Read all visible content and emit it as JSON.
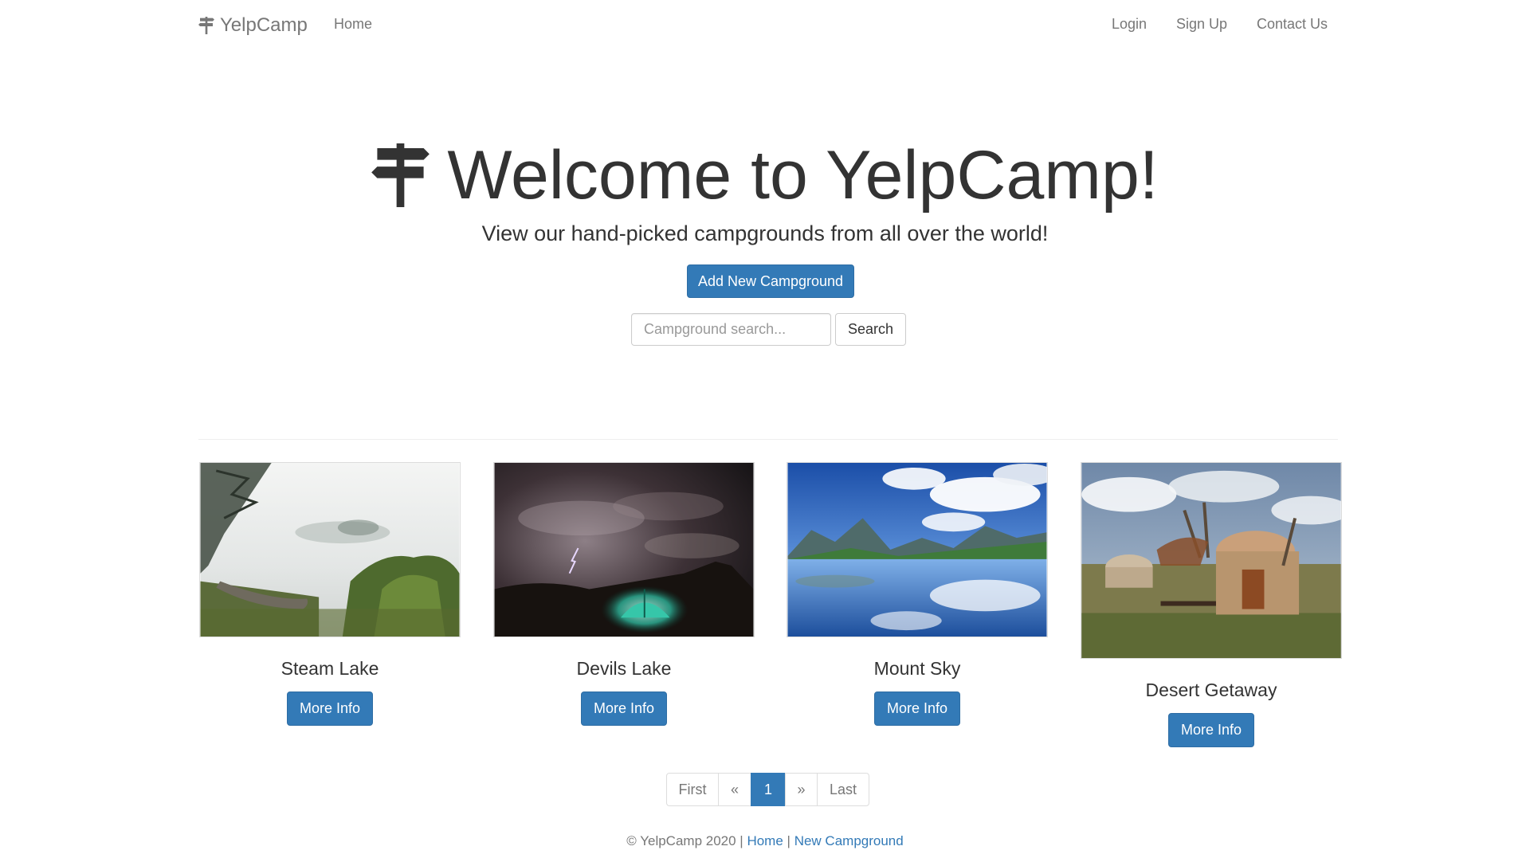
{
  "navbar": {
    "brand": "YelpCamp",
    "home": "Home",
    "login": "Login",
    "signup": "Sign Up",
    "contact": "Contact Us"
  },
  "hero": {
    "title": "Welcome to YelpCamp!",
    "subtitle": "View our hand-picked campgrounds from all over the world!",
    "add_button": "Add New Campground",
    "search_placeholder": "Campground search...",
    "search_button": "Search"
  },
  "campgrounds": [
    {
      "name": "Steam Lake",
      "button": "More Info"
    },
    {
      "name": "Devils Lake",
      "button": "More Info"
    },
    {
      "name": "Mount Sky",
      "button": "More Info"
    },
    {
      "name": "Desert Getaway",
      "button": "More Info"
    }
  ],
  "pagination": {
    "first": "First",
    "prev": "«",
    "current": "1",
    "next": "»",
    "last": "Last"
  },
  "footer": {
    "copyright": "© YelpCamp 2020",
    "separator": "|",
    "home_link": "Home",
    "new_link": "New Campground"
  },
  "colors": {
    "primary": "#337ab7",
    "nav_text": "#777777",
    "text": "#333333"
  },
  "icons": {
    "brand": "signpost-icon",
    "hero": "signpost-icon"
  }
}
